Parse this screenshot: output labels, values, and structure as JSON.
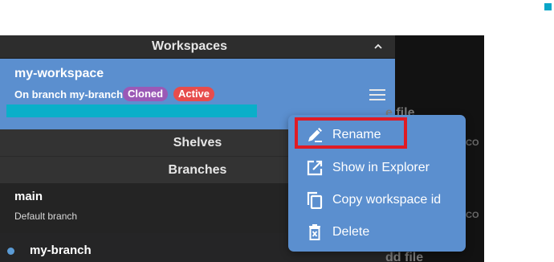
{
  "workspaces_panel": {
    "header_title": "Workspaces",
    "workspace": {
      "name": "my-workspace",
      "branch_text": "On branch my-branch",
      "badges": [
        {
          "label": "Cloned",
          "color": "#9b59b6"
        },
        {
          "label": "Active",
          "color": "#e74c4c"
        }
      ],
      "progress_fraction": 1.0,
      "accent_color": "#5b8fcf",
      "progress_color": "#0aafc9"
    },
    "sections": {
      "shelves_label": "Shelves",
      "branches_label": "Branches"
    },
    "branches": [
      {
        "name": "main",
        "description": "Default branch"
      },
      {
        "name": "my-branch"
      }
    ]
  },
  "right_pane": {
    "ghost_texts": [
      "e file",
      "CO",
      "CO",
      "dd file"
    ]
  },
  "context_menu": {
    "items": [
      {
        "label": "Rename",
        "icon": "pencil-icon",
        "highlighted": true
      },
      {
        "label": "Show in Explorer",
        "icon": "open-external-icon"
      },
      {
        "label": "Copy workspace id",
        "icon": "copy-icon"
      },
      {
        "label": "Delete",
        "icon": "trash-icon"
      }
    ],
    "highlight_color": "#e01b24"
  }
}
